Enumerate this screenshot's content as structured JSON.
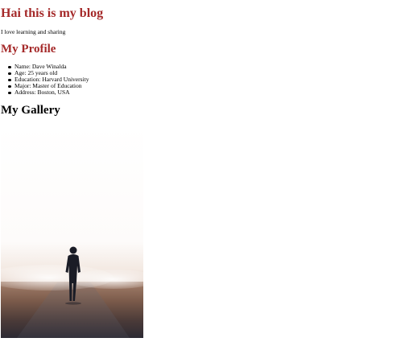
{
  "header": {
    "title": "Hai this is my blog",
    "tagline": "I love learning and sharing"
  },
  "profile": {
    "title": "My Profile",
    "items": [
      "Name: Dave Winalda",
      "Age: 25 years old",
      "Education: Harvard University",
      "Major: Master of Education",
      "Address: Boston, USA"
    ]
  },
  "gallery": {
    "title": "My Gallery",
    "image_icon": "person-walking-on-foggy-road-photo"
  },
  "colors": {
    "heading_accent": "#a52a2a",
    "body_text": "#000000",
    "background": "#ffffff"
  }
}
